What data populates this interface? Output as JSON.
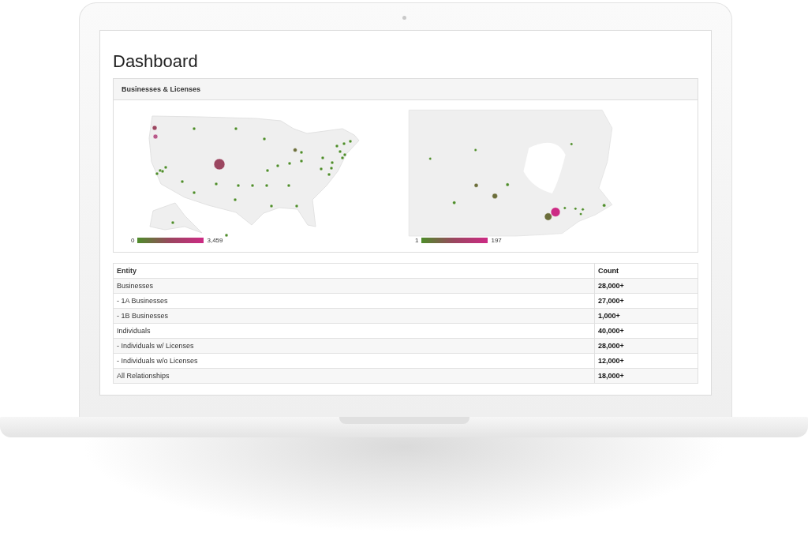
{
  "page": {
    "title": "Dashboard"
  },
  "panel": {
    "title": "Businesses & Licenses",
    "maps": [
      {
        "kind": "usa",
        "legend_min": "0",
        "legend_max": "3,459"
      },
      {
        "kind": "canada",
        "legend_min": "1",
        "legend_max": "197"
      }
    ]
  },
  "table": {
    "columns": [
      "Entity",
      "Count"
    ],
    "rows": [
      {
        "entity": "Businesses",
        "count": "28,000+"
      },
      {
        "entity": "- 1A Businesses",
        "count": "27,000+"
      },
      {
        "entity": "- 1B Businesses",
        "count": "1,000+"
      },
      {
        "entity": "Individuals",
        "count": "40,000+"
      },
      {
        "entity": "- Individuals w/ Licenses",
        "count": "28,000+"
      },
      {
        "entity": "- Individuals w/o Licenses",
        "count": "12,000+"
      },
      {
        "entity": "All Relationships",
        "count": "18,000+"
      }
    ]
  }
}
